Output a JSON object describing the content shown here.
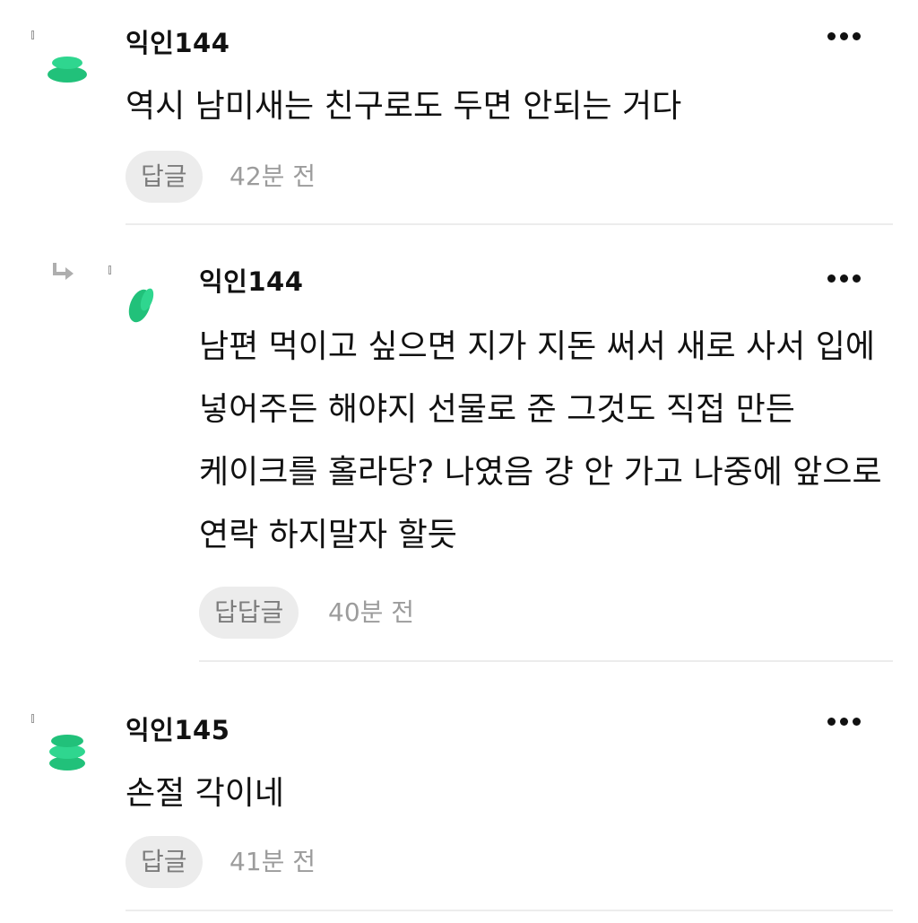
{
  "colors": {
    "avatar_green": "#21c17a",
    "avatar_green_light": "#2fd68f",
    "button_bg": "#ececec",
    "button_text": "#7d7d7d",
    "meta_text": "#9c9c9c",
    "divider": "#ececec"
  },
  "comments": [
    {
      "author": "익인144",
      "text": "역시 남미새는 친구로도 두면 안되는 거다",
      "reply_label": "답글",
      "time": "42분 전",
      "more_icon": "more-horizontal-icon",
      "avatar_icon": "green-stack-avatar-icon"
    },
    {
      "author": "익인144",
      "text": "남편 먹이고 싶으면 지가 지돈 써서 새로 사서 입에 넣어주든 해야지 선물로 준 그것도 직접 만든 케이크를 홀라당? 나였음 걍 안 가고 나중에 앞으로 연락 하지말자 할듯",
      "reply_label": "답답글",
      "time": "40분 전",
      "more_icon": "more-horizontal-icon",
      "avatar_icon": "green-tilted-avatar-icon",
      "reply_indicator_icon": "reply-arrow-icon"
    },
    {
      "author": "익인145",
      "text": "손절 각이네",
      "reply_label": "답글",
      "time": "41분 전",
      "more_icon": "more-horizontal-icon",
      "avatar_icon": "green-stack-avatar-icon"
    }
  ]
}
